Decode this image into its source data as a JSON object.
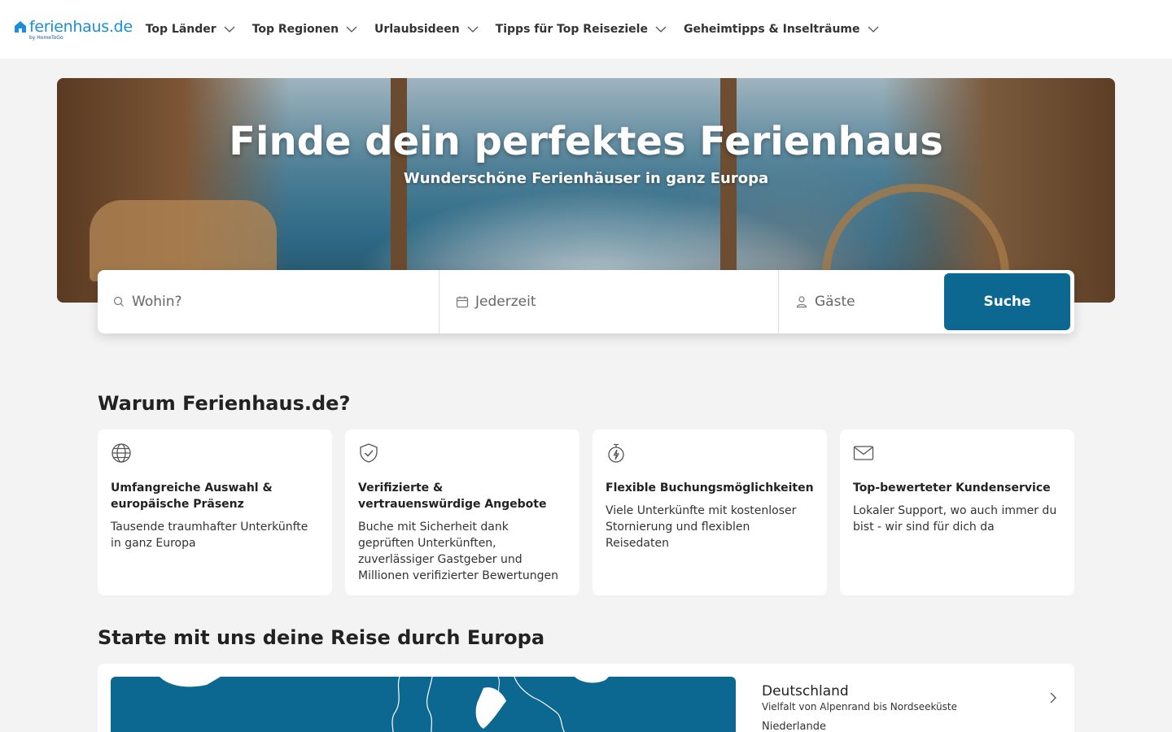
{
  "header": {
    "logo_text": "ferienhaus.de",
    "logo_sub": "by HomeToGo",
    "nav": [
      {
        "label": "Top Länder"
      },
      {
        "label": "Top Regionen"
      },
      {
        "label": "Urlaubsideen"
      },
      {
        "label": "Tipps für Top Reiseziele"
      },
      {
        "label": "Geheimtipps & Inselträume"
      }
    ]
  },
  "hero": {
    "title": "Finde dein perfektes Ferienhaus",
    "subtitle": "Wunderschöne Ferienhäuser in ganz Europa"
  },
  "search": {
    "where_placeholder": "Wohin?",
    "when_label": "Jederzeit",
    "guests_label": "Gäste",
    "button_label": "Suche"
  },
  "why": {
    "title": "Warum Ferienhaus.de?",
    "cards": [
      {
        "icon": "globe-icon",
        "title": "Umfangreiche Auswahl & europäische Präsenz",
        "text": "Tausende traumhafter Unterkünfte in ganz Europa"
      },
      {
        "icon": "shield-check-icon",
        "title": "Verifizierte & vertrauenswürdige Angebote",
        "text": "Buche mit Sicherheit dank geprüften Unterkünften, zuverlässiger Gastgeber und Millionen verifizierter Bewertungen"
      },
      {
        "icon": "stopwatch-bolt-icon",
        "title": "Flexible Buchungsmöglichkeiten",
        "text": "Viele Unterkünfte mit kostenloser Stornierung und flexiblen Reisedaten"
      },
      {
        "icon": "envelope-icon",
        "title": "Top-bewerteter Kundenservice",
        "text": "Lokaler Support, wo auch immer du bist - wir sind für dich da"
      }
    ]
  },
  "europe": {
    "title": "Starte mit uns deine Reise durch Europa",
    "country": {
      "name": "Deutschland",
      "desc": "Vielfalt von Alpenrand bis Nordseeküste"
    },
    "next_country": "Niederlande"
  },
  "colors": {
    "brand_blue": "#0c6791",
    "logo_blue": "#1a8fd6"
  }
}
